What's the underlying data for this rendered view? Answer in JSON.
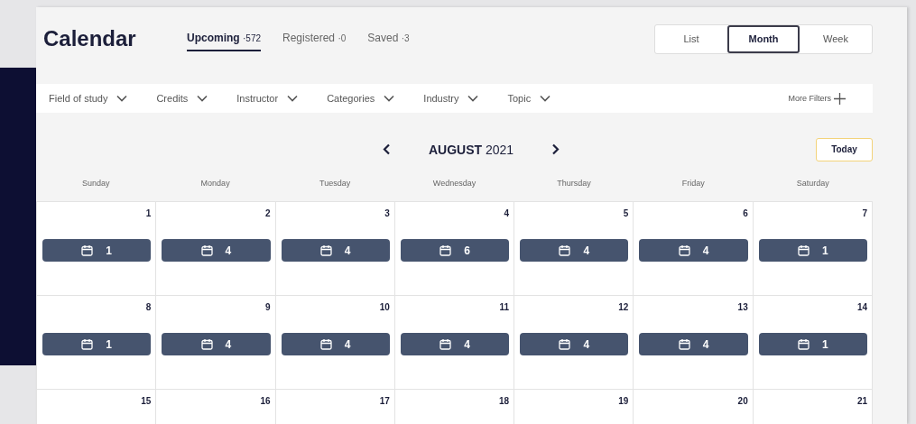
{
  "header": {
    "title": "Calendar"
  },
  "tabs": [
    {
      "label": "Upcoming",
      "count": "·572",
      "selected": true
    },
    {
      "label": "Registered",
      "count": "·0",
      "selected": false
    },
    {
      "label": "Saved",
      "count": "·3",
      "selected": false
    }
  ],
  "views": [
    {
      "label": "List",
      "selected": false
    },
    {
      "label": "Month",
      "selected": true
    },
    {
      "label": "Week",
      "selected": false
    }
  ],
  "filters": [
    {
      "label": "Field of study"
    },
    {
      "label": "Credits"
    },
    {
      "label": "Instructor"
    },
    {
      "label": "Categories"
    },
    {
      "label": "Industry"
    },
    {
      "label": "Topic"
    }
  ],
  "more_filters": "More Filters",
  "month_nav": {
    "month": "AUGUST",
    "year": "2021"
  },
  "today_button": "Today",
  "weekdays": [
    "Sunday",
    "Monday",
    "Tuesday",
    "Wednesday",
    "Thursday",
    "Friday",
    "Saturday"
  ],
  "weeks": [
    [
      {
        "day": "1",
        "events": "1"
      },
      {
        "day": "2",
        "events": "4"
      },
      {
        "day": "3",
        "events": "4"
      },
      {
        "day": "4",
        "events": "6"
      },
      {
        "day": "5",
        "events": "4"
      },
      {
        "day": "6",
        "events": "4"
      },
      {
        "day": "7",
        "events": "1"
      }
    ],
    [
      {
        "day": "8",
        "events": "1"
      },
      {
        "day": "9",
        "events": "4"
      },
      {
        "day": "10",
        "events": "4"
      },
      {
        "day": "11",
        "events": "4"
      },
      {
        "day": "12",
        "events": "4"
      },
      {
        "day": "13",
        "events": "4"
      },
      {
        "day": "14",
        "events": "1"
      }
    ],
    [
      {
        "day": "15"
      },
      {
        "day": "16"
      },
      {
        "day": "17"
      },
      {
        "day": "18"
      },
      {
        "day": "19"
      },
      {
        "day": "20"
      },
      {
        "day": "21"
      }
    ]
  ]
}
